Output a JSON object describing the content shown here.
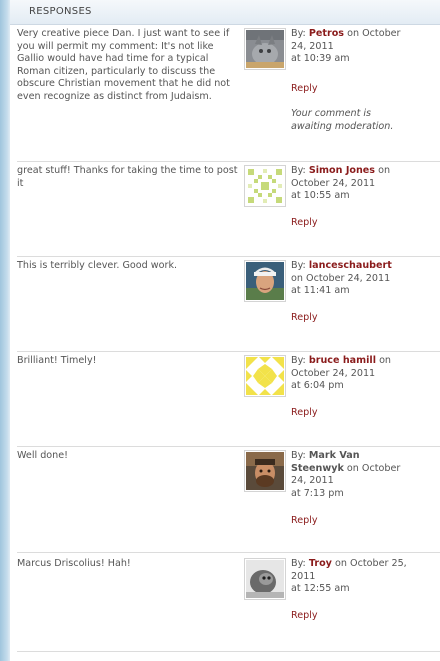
{
  "header": {
    "title": "RESPONSES"
  },
  "by_label": "By:",
  "on_label": "on",
  "comments": [
    {
      "text": "Very creative piece Dan. I just want to see if you will permit my comment: It's not like Gallio would have had time for a typical Roman citizen, particularly to discuss the obscure Christian movement that he did not even recognize as distinct from Judaism.",
      "author": "Petros",
      "date": "October 24, 2011",
      "time": "at 10:39 am",
      "reply": "Reply",
      "moderation": "Your comment is awaiting moderation."
    },
    {
      "text": "great stuff! Thanks for taking the time to post it",
      "author": "Simon Jones",
      "date": "October 24, 2011",
      "time": "at 10:55 am",
      "reply": "Reply"
    },
    {
      "text": "This is terribly clever. Good work.",
      "author": "lanceschaubert",
      "date": "October 24, 2011",
      "time": "at 11:41 am",
      "reply": "Reply"
    },
    {
      "text": "Brilliant! Timely!",
      "author": "bruce hamill",
      "date": "October 24, 2011",
      "time": "at 6:04 pm",
      "reply": "Reply"
    },
    {
      "text": "Well done!",
      "author": "Mark Van Steenwyk",
      "date": "October 24, 2011",
      "time": "at 7:13 pm",
      "reply": "Reply"
    },
    {
      "text": "Marcus Driscolius! Hah!",
      "author": "Troy",
      "date": "October 25, 2011",
      "time": "at 12:55 am",
      "reply": "Reply"
    }
  ]
}
